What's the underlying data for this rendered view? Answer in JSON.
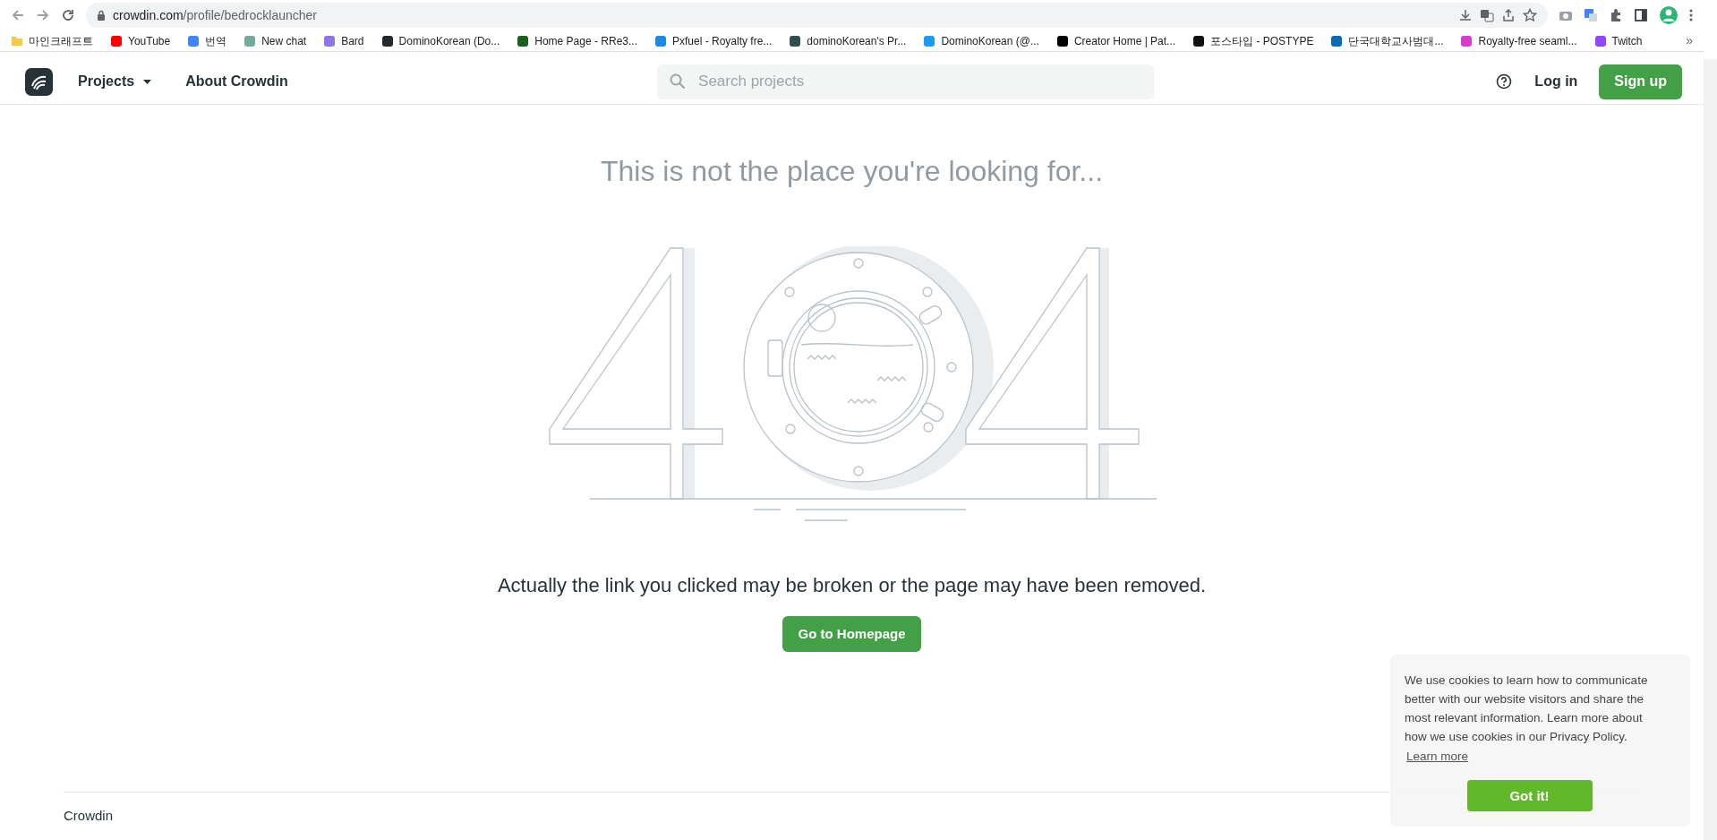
{
  "browser": {
    "url_host": "crowdin.com",
    "url_path": "/profile/bedrocklauncher",
    "bookmarks": [
      {
        "kind": "folder",
        "label": "마인크래프트",
        "color": "#f7c948"
      },
      {
        "kind": "site",
        "label": "YouTube",
        "color": "#ff0000"
      },
      {
        "kind": "site",
        "label": "번역",
        "color": "#4285f4"
      },
      {
        "kind": "site",
        "label": "New chat",
        "color": "#74aa9c"
      },
      {
        "kind": "site",
        "label": "Bard",
        "color": "#8e75e8"
      },
      {
        "kind": "site",
        "label": "DominoKorean (Do...",
        "color": "#24292f"
      },
      {
        "kind": "site",
        "label": "Home Page - RRe3...",
        "color": "#1b5e20"
      },
      {
        "kind": "site",
        "label": "Pxfuel - Royalty fre...",
        "color": "#1e88e5"
      },
      {
        "kind": "site",
        "label": "dominoKorean's Pr...",
        "color": "#2f4f4f"
      },
      {
        "kind": "site",
        "label": "DominoKorean (@...",
        "color": "#1d9bf0"
      },
      {
        "kind": "site",
        "label": "Creator Home | Pat...",
        "color": "#000000"
      },
      {
        "kind": "site",
        "label": "포스타입 - POSTYPE",
        "color": "#111111"
      },
      {
        "kind": "site",
        "label": "단국대학교사범대...",
        "color": "#0a6ab5"
      },
      {
        "kind": "site",
        "label": "Royalty-free seaml...",
        "color": "#d63ccf"
      },
      {
        "kind": "site",
        "label": "Twitch",
        "color": "#9146ff"
      }
    ],
    "more": "»"
  },
  "header": {
    "nav": [
      {
        "label": "Projects",
        "dropdown": true
      },
      {
        "label": "About Crowdin",
        "dropdown": false
      }
    ],
    "search": {
      "placeholder": "Search projects"
    },
    "login": "Log in",
    "signup": "Sign up"
  },
  "main": {
    "title": "This is not the place you're looking for...",
    "message": "Actually the link you clicked may be broken or the page may have been removed.",
    "button": "Go to Homepage"
  },
  "footer": {
    "brand": "Crowdin"
  },
  "cookie_banner": {
    "text": "We use cookies to learn how to communicate better with our website visitors and share the most relevant information. Learn more about how we use cookies in our Privacy Policy.",
    "link": "Learn more",
    "button": "Got it!"
  }
}
